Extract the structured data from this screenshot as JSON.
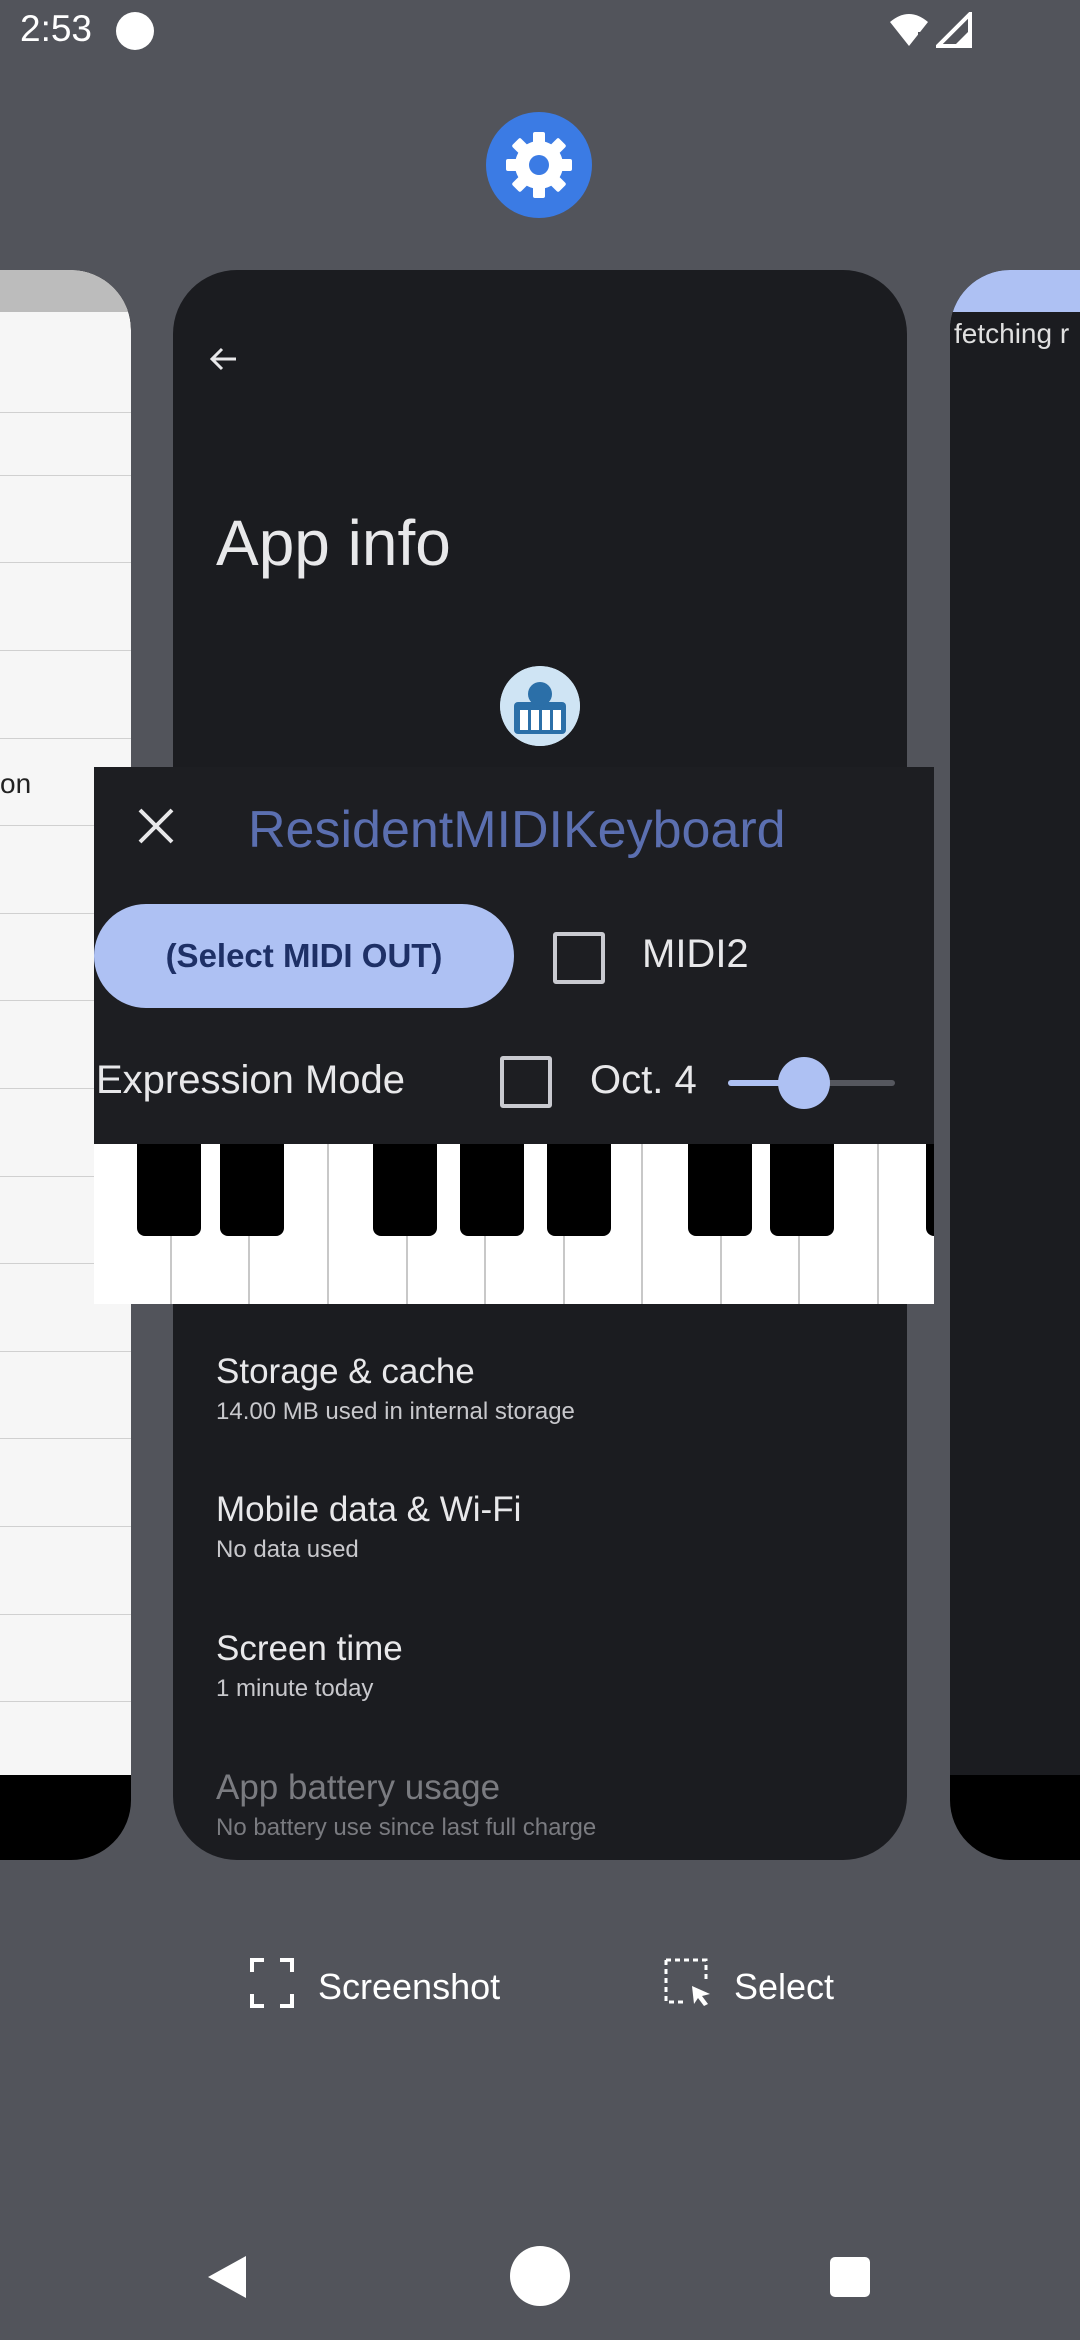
{
  "status_bar": {
    "time": "2:53",
    "icons": [
      "notification-dot-icon",
      "wifi-icon",
      "signal-icon"
    ]
  },
  "app_icon": "settings-gear-icon",
  "left_card": {
    "partial_text": "on"
  },
  "right_card": {
    "partial_text": "fetching r"
  },
  "app_info": {
    "title": "App info",
    "app_icon": "resident-midi-app-icon",
    "settings": [
      {
        "title": "Storage & cache",
        "subtitle": "14.00 MB used in internal storage"
      },
      {
        "title": "Mobile data & Wi-Fi",
        "subtitle": "No data used"
      },
      {
        "title": "Screen time",
        "subtitle": "1 minute today"
      },
      {
        "title": "App battery usage",
        "subtitle": "No battery use since last full charge"
      }
    ]
  },
  "midi_panel": {
    "title": "ResidentMIDIKeyboard",
    "select_midi_out": "(Select MIDI OUT)",
    "midi2_label": "MIDI2",
    "midi2_checked": false,
    "expression_mode_label": "Expression Mode",
    "expression_mode_checked": false,
    "octave_label": "Oct. 4",
    "octave_slider_fraction": 0.45
  },
  "actions": {
    "screenshot": "Screenshot",
    "select": "Select"
  },
  "colors": {
    "accent": "#aec1f3",
    "background": "#52545b",
    "card": "#1b1c20",
    "title_blue": "#5b6fb0"
  }
}
